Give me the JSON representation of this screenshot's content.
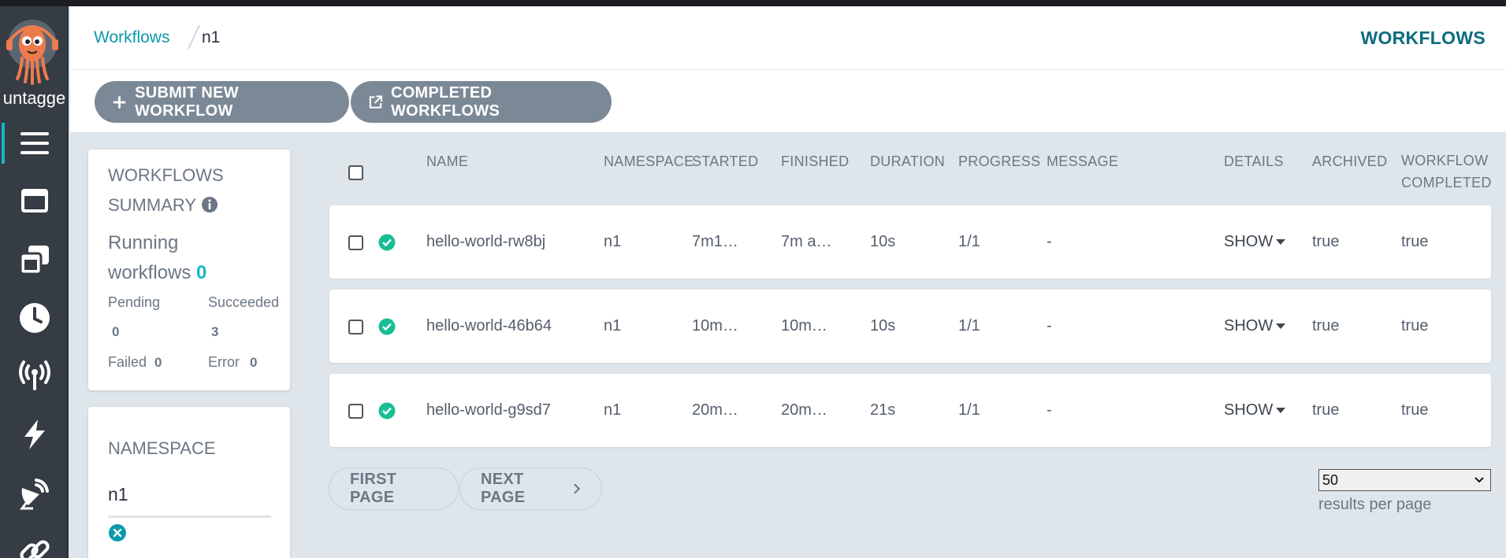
{
  "sidebar": {
    "user_label": "untagge",
    "nav": [
      {
        "name": "workflows",
        "icon": "list-icon"
      },
      {
        "name": "workflow-templates",
        "icon": "window-icon"
      },
      {
        "name": "cluster-workflow-templates",
        "icon": "clone-icon"
      },
      {
        "name": "cron-workflows",
        "icon": "clock-icon"
      },
      {
        "name": "event-sources",
        "icon": "broadcast-tower-icon"
      },
      {
        "name": "sensors",
        "icon": "bolt-icon"
      },
      {
        "name": "event-flow",
        "icon": "satellite-dish-icon"
      },
      {
        "name": "links",
        "icon": "link-icon"
      }
    ]
  },
  "breadcrumb": {
    "link": "Workflows",
    "current": "n1"
  },
  "page_title": "WORKFLOWS",
  "toolbar": {
    "submit_label": "SUBMIT NEW WORKFLOW",
    "completed_label": "COMPLETED WORKFLOWS"
  },
  "summary": {
    "title_line1": "WORKFLOWS",
    "title_line2": "SUMMARY",
    "running_line1": "Running",
    "running_line2": "workflows",
    "running_count": "0",
    "pending_label": "Pending",
    "pending_count": "0",
    "succeeded_label": "Succeeded",
    "succeeded_count": "3",
    "failed_label": "Failed",
    "failed_count": "0",
    "error_label": "Error",
    "error_count": "0"
  },
  "namespace": {
    "title": "NAMESPACE",
    "value": "n1"
  },
  "table": {
    "headers": {
      "name": "NAME",
      "namespace": "NAMESPACE",
      "started": "STARTED",
      "finished": "FINISHED",
      "duration": "DURATION",
      "progress": "PROGRESS",
      "message": "MESSAGE",
      "details": "DETAILS",
      "archived": "ARCHIVED",
      "completed_line1": "WORKFLOW",
      "completed_line2": "COMPLETED"
    },
    "rows": [
      {
        "name": "hello-world-rw8bj",
        "namespace": "n1",
        "started": "7m1…",
        "finished": "7m a…",
        "duration": "10s",
        "progress": "1/1",
        "message": "-",
        "details": "SHOW",
        "archived": "true",
        "completed": "true",
        "status": "succeeded"
      },
      {
        "name": "hello-world-46b64",
        "namespace": "n1",
        "started": "10m…",
        "finished": "10m…",
        "duration": "10s",
        "progress": "1/1",
        "message": "-",
        "details": "SHOW",
        "archived": "true",
        "completed": "true",
        "status": "succeeded"
      },
      {
        "name": "hello-world-g9sd7",
        "namespace": "n1",
        "started": "20m…",
        "finished": "20m…",
        "duration": "21s",
        "progress": "1/1",
        "message": "-",
        "details": "SHOW",
        "archived": "true",
        "completed": "true",
        "status": "succeeded"
      }
    ]
  },
  "pagination": {
    "first_label": "FIRST PAGE",
    "next_label": "NEXT PAGE",
    "per_page_value": "50",
    "per_page_label": "results per page"
  },
  "colors": {
    "accent": "#18b6c8",
    "success": "#18be94",
    "sidebar_bg": "#363c44",
    "button_bg": "#7b8896",
    "title": "#0e6a80"
  }
}
